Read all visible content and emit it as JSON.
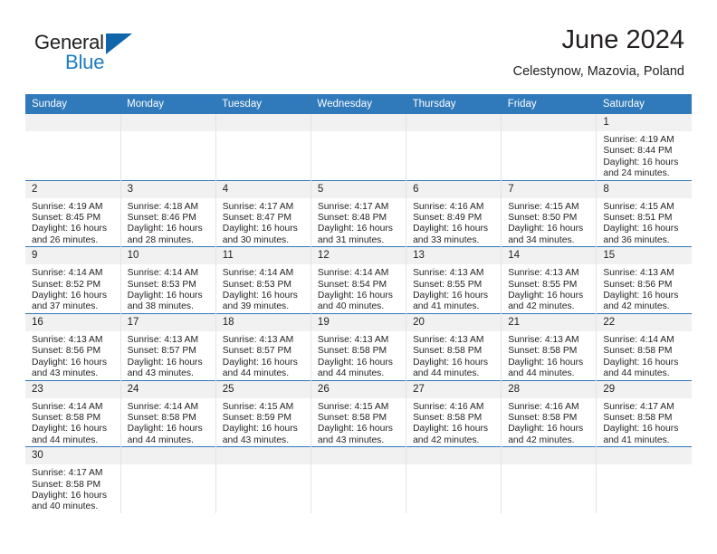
{
  "brand": {
    "name_part1": "General",
    "name_part2": "Blue",
    "logo_icon": "triangle-icon",
    "color": "#1166ab"
  },
  "header": {
    "title": "June 2024",
    "subtitle": "Celestynow, Mazovia, Poland"
  },
  "theme": {
    "header_blue": "#3079ba",
    "daystrip_gray": "#f1f1f1",
    "text": "#231f20"
  },
  "calendar": {
    "weekday_headers": [
      "Sunday",
      "Monday",
      "Tuesday",
      "Wednesday",
      "Thursday",
      "Friday",
      "Saturday"
    ],
    "labels": {
      "sunrise": "Sunrise:",
      "sunset": "Sunset:",
      "daylight": "Daylight:"
    },
    "weeks": [
      [
        {
          "day": "",
          "empty": true,
          "sunrise": "",
          "sunset": "",
          "daylight1": "",
          "daylight2": ""
        },
        {
          "day": "",
          "empty": true,
          "sunrise": "",
          "sunset": "",
          "daylight1": "",
          "daylight2": ""
        },
        {
          "day": "",
          "empty": true,
          "sunrise": "",
          "sunset": "",
          "daylight1": "",
          "daylight2": ""
        },
        {
          "day": "",
          "empty": true,
          "sunrise": "",
          "sunset": "",
          "daylight1": "",
          "daylight2": ""
        },
        {
          "day": "",
          "empty": true,
          "sunrise": "",
          "sunset": "",
          "daylight1": "",
          "daylight2": ""
        },
        {
          "day": "",
          "empty": true,
          "sunrise": "",
          "sunset": "",
          "daylight1": "",
          "daylight2": ""
        },
        {
          "day": "1",
          "empty": false,
          "sunrise": "Sunrise: 4:19 AM",
          "sunset": "Sunset: 8:44 PM",
          "daylight1": "Daylight: 16 hours",
          "daylight2": "and 24 minutes."
        }
      ],
      [
        {
          "day": "2",
          "empty": false,
          "sunrise": "Sunrise: 4:19 AM",
          "sunset": "Sunset: 8:45 PM",
          "daylight1": "Daylight: 16 hours",
          "daylight2": "and 26 minutes."
        },
        {
          "day": "3",
          "empty": false,
          "sunrise": "Sunrise: 4:18 AM",
          "sunset": "Sunset: 8:46 PM",
          "daylight1": "Daylight: 16 hours",
          "daylight2": "and 28 minutes."
        },
        {
          "day": "4",
          "empty": false,
          "sunrise": "Sunrise: 4:17 AM",
          "sunset": "Sunset: 8:47 PM",
          "daylight1": "Daylight: 16 hours",
          "daylight2": "and 30 minutes."
        },
        {
          "day": "5",
          "empty": false,
          "sunrise": "Sunrise: 4:17 AM",
          "sunset": "Sunset: 8:48 PM",
          "daylight1": "Daylight: 16 hours",
          "daylight2": "and 31 minutes."
        },
        {
          "day": "6",
          "empty": false,
          "sunrise": "Sunrise: 4:16 AM",
          "sunset": "Sunset: 8:49 PM",
          "daylight1": "Daylight: 16 hours",
          "daylight2": "and 33 minutes."
        },
        {
          "day": "7",
          "empty": false,
          "sunrise": "Sunrise: 4:15 AM",
          "sunset": "Sunset: 8:50 PM",
          "daylight1": "Daylight: 16 hours",
          "daylight2": "and 34 minutes."
        },
        {
          "day": "8",
          "empty": false,
          "sunrise": "Sunrise: 4:15 AM",
          "sunset": "Sunset: 8:51 PM",
          "daylight1": "Daylight: 16 hours",
          "daylight2": "and 36 minutes."
        }
      ],
      [
        {
          "day": "9",
          "empty": false,
          "sunrise": "Sunrise: 4:14 AM",
          "sunset": "Sunset: 8:52 PM",
          "daylight1": "Daylight: 16 hours",
          "daylight2": "and 37 minutes."
        },
        {
          "day": "10",
          "empty": false,
          "sunrise": "Sunrise: 4:14 AM",
          "sunset": "Sunset: 8:53 PM",
          "daylight1": "Daylight: 16 hours",
          "daylight2": "and 38 minutes."
        },
        {
          "day": "11",
          "empty": false,
          "sunrise": "Sunrise: 4:14 AM",
          "sunset": "Sunset: 8:53 PM",
          "daylight1": "Daylight: 16 hours",
          "daylight2": "and 39 minutes."
        },
        {
          "day": "12",
          "empty": false,
          "sunrise": "Sunrise: 4:14 AM",
          "sunset": "Sunset: 8:54 PM",
          "daylight1": "Daylight: 16 hours",
          "daylight2": "and 40 minutes."
        },
        {
          "day": "13",
          "empty": false,
          "sunrise": "Sunrise: 4:13 AM",
          "sunset": "Sunset: 8:55 PM",
          "daylight1": "Daylight: 16 hours",
          "daylight2": "and 41 minutes."
        },
        {
          "day": "14",
          "empty": false,
          "sunrise": "Sunrise: 4:13 AM",
          "sunset": "Sunset: 8:55 PM",
          "daylight1": "Daylight: 16 hours",
          "daylight2": "and 42 minutes."
        },
        {
          "day": "15",
          "empty": false,
          "sunrise": "Sunrise: 4:13 AM",
          "sunset": "Sunset: 8:56 PM",
          "daylight1": "Daylight: 16 hours",
          "daylight2": "and 42 minutes."
        }
      ],
      [
        {
          "day": "16",
          "empty": false,
          "sunrise": "Sunrise: 4:13 AM",
          "sunset": "Sunset: 8:56 PM",
          "daylight1": "Daylight: 16 hours",
          "daylight2": "and 43 minutes."
        },
        {
          "day": "17",
          "empty": false,
          "sunrise": "Sunrise: 4:13 AM",
          "sunset": "Sunset: 8:57 PM",
          "daylight1": "Daylight: 16 hours",
          "daylight2": "and 43 minutes."
        },
        {
          "day": "18",
          "empty": false,
          "sunrise": "Sunrise: 4:13 AM",
          "sunset": "Sunset: 8:57 PM",
          "daylight1": "Daylight: 16 hours",
          "daylight2": "and 44 minutes."
        },
        {
          "day": "19",
          "empty": false,
          "sunrise": "Sunrise: 4:13 AM",
          "sunset": "Sunset: 8:58 PM",
          "daylight1": "Daylight: 16 hours",
          "daylight2": "and 44 minutes."
        },
        {
          "day": "20",
          "empty": false,
          "sunrise": "Sunrise: 4:13 AM",
          "sunset": "Sunset: 8:58 PM",
          "daylight1": "Daylight: 16 hours",
          "daylight2": "and 44 minutes."
        },
        {
          "day": "21",
          "empty": false,
          "sunrise": "Sunrise: 4:13 AM",
          "sunset": "Sunset: 8:58 PM",
          "daylight1": "Daylight: 16 hours",
          "daylight2": "and 44 minutes."
        },
        {
          "day": "22",
          "empty": false,
          "sunrise": "Sunrise: 4:14 AM",
          "sunset": "Sunset: 8:58 PM",
          "daylight1": "Daylight: 16 hours",
          "daylight2": "and 44 minutes."
        }
      ],
      [
        {
          "day": "23",
          "empty": false,
          "sunrise": "Sunrise: 4:14 AM",
          "sunset": "Sunset: 8:58 PM",
          "daylight1": "Daylight: 16 hours",
          "daylight2": "and 44 minutes."
        },
        {
          "day": "24",
          "empty": false,
          "sunrise": "Sunrise: 4:14 AM",
          "sunset": "Sunset: 8:58 PM",
          "daylight1": "Daylight: 16 hours",
          "daylight2": "and 44 minutes."
        },
        {
          "day": "25",
          "empty": false,
          "sunrise": "Sunrise: 4:15 AM",
          "sunset": "Sunset: 8:59 PM",
          "daylight1": "Daylight: 16 hours",
          "daylight2": "and 43 minutes."
        },
        {
          "day": "26",
          "empty": false,
          "sunrise": "Sunrise: 4:15 AM",
          "sunset": "Sunset: 8:58 PM",
          "daylight1": "Daylight: 16 hours",
          "daylight2": "and 43 minutes."
        },
        {
          "day": "27",
          "empty": false,
          "sunrise": "Sunrise: 4:16 AM",
          "sunset": "Sunset: 8:58 PM",
          "daylight1": "Daylight: 16 hours",
          "daylight2": "and 42 minutes."
        },
        {
          "day": "28",
          "empty": false,
          "sunrise": "Sunrise: 4:16 AM",
          "sunset": "Sunset: 8:58 PM",
          "daylight1": "Daylight: 16 hours",
          "daylight2": "and 42 minutes."
        },
        {
          "day": "29",
          "empty": false,
          "sunrise": "Sunrise: 4:17 AM",
          "sunset": "Sunset: 8:58 PM",
          "daylight1": "Daylight: 16 hours",
          "daylight2": "and 41 minutes."
        }
      ],
      [
        {
          "day": "30",
          "empty": false,
          "sunrise": "Sunrise: 4:17 AM",
          "sunset": "Sunset: 8:58 PM",
          "daylight1": "Daylight: 16 hours",
          "daylight2": "and 40 minutes."
        },
        {
          "day": "",
          "empty": true,
          "sunrise": "",
          "sunset": "",
          "daylight1": "",
          "daylight2": ""
        },
        {
          "day": "",
          "empty": true,
          "sunrise": "",
          "sunset": "",
          "daylight1": "",
          "daylight2": ""
        },
        {
          "day": "",
          "empty": true,
          "sunrise": "",
          "sunset": "",
          "daylight1": "",
          "daylight2": ""
        },
        {
          "day": "",
          "empty": true,
          "sunrise": "",
          "sunset": "",
          "daylight1": "",
          "daylight2": ""
        },
        {
          "day": "",
          "empty": true,
          "sunrise": "",
          "sunset": "",
          "daylight1": "",
          "daylight2": ""
        },
        {
          "day": "",
          "empty": true,
          "sunrise": "",
          "sunset": "",
          "daylight1": "",
          "daylight2": ""
        }
      ]
    ]
  }
}
